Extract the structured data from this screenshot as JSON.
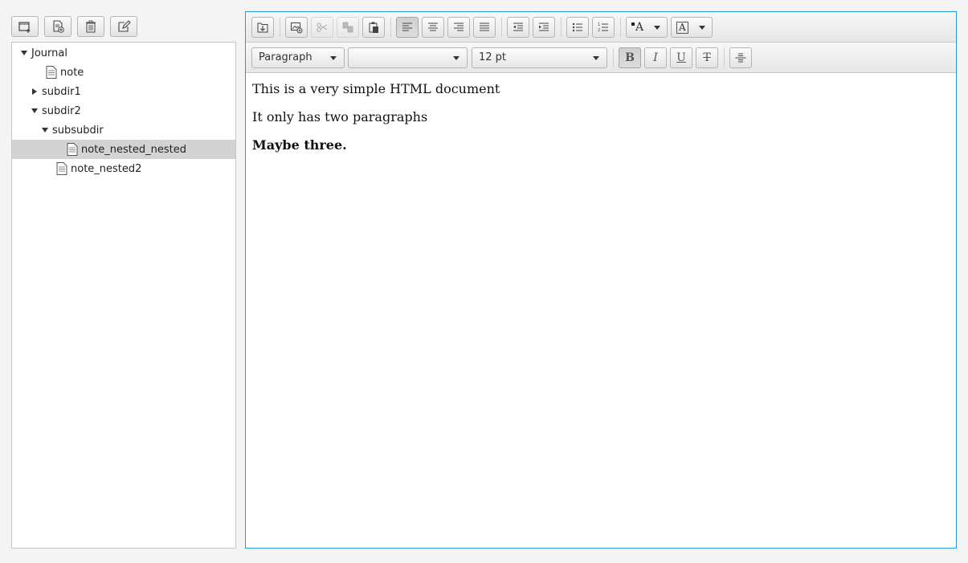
{
  "tree": {
    "rows": [
      {
        "label": "Journal",
        "kind": "folder",
        "expanded": true
      },
      {
        "label": "note",
        "kind": "file"
      },
      {
        "label": "subdir1",
        "kind": "folder",
        "expanded": false
      },
      {
        "label": "subdir2",
        "kind": "folder",
        "expanded": true
      },
      {
        "label": "subsubdir",
        "kind": "folder",
        "expanded": true
      },
      {
        "label": "note_nested_nested",
        "kind": "file",
        "selected": true
      },
      {
        "label": "note_nested2",
        "kind": "file"
      }
    ]
  },
  "editor": {
    "paragraph_style": "Paragraph",
    "font_family": "",
    "font_size": "12 pt",
    "format_bold": "B",
    "format_italic": "I",
    "format_underline": "U",
    "format_strike": "T",
    "text_color_glyph": "A",
    "highlight_glyph": "A"
  },
  "document": {
    "paragraphs": [
      "This is a very simple HTML document",
      "It only has two paragraphs",
      "Maybe three."
    ]
  },
  "colors": {
    "focus_border": "#2b9ad6",
    "selection": "#d3d3d3"
  }
}
